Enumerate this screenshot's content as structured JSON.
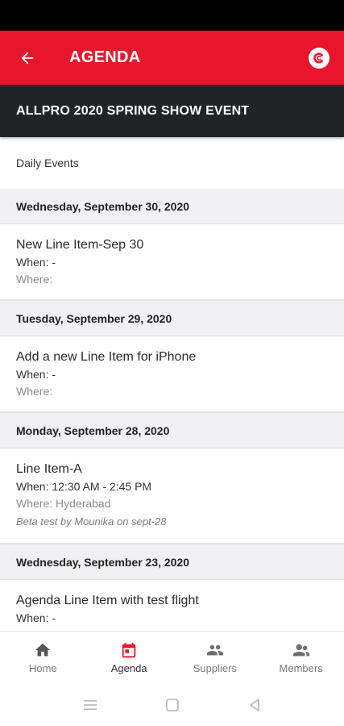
{
  "app_bar": {
    "title": "AGENDA",
    "back_icon": "arrow-left-icon",
    "logo_icon": "brand-logo-icon"
  },
  "event": {
    "name": "ALLPRO 2020 SPRING SHOW EVENT"
  },
  "section_label": "Daily Events",
  "days": [
    {
      "date": "Wednesday, September 30, 2020",
      "items": [
        {
          "name": "New Line Item-Sep 30",
          "when": "When: -",
          "where": "Where:",
          "note": ""
        }
      ]
    },
    {
      "date": "Tuesday, September 29, 2020",
      "items": [
        {
          "name": "Add a new Line Item for iPhone",
          "when": "When: -",
          "where": "Where:",
          "note": ""
        }
      ]
    },
    {
      "date": "Monday, September 28, 2020",
      "items": [
        {
          "name": "Line Item-A",
          "when": "When: 12:30 AM - 2:45 PM",
          "where": "Where: Hyderabad",
          "note": "Beta test by Mounika on sept-28"
        }
      ]
    },
    {
      "date": "Wednesday, September 23, 2020",
      "items": [
        {
          "name": "Agenda Line Item with test flight",
          "when": "When: -",
          "where": "",
          "note": ""
        }
      ]
    }
  ],
  "bottom_nav": [
    {
      "label": "Home",
      "icon": "home-icon",
      "active": false
    },
    {
      "label": "Agenda",
      "icon": "calendar-icon",
      "active": true
    },
    {
      "label": "Suppliers",
      "icon": "people-icon",
      "active": false
    },
    {
      "label": "Members",
      "icon": "members-icon",
      "active": false
    }
  ],
  "colors": {
    "primary": "#e8162d",
    "dark_bar": "#222326",
    "day_header_bg": "#f1f1f3",
    "icon_gray": "#6e6e6e"
  }
}
